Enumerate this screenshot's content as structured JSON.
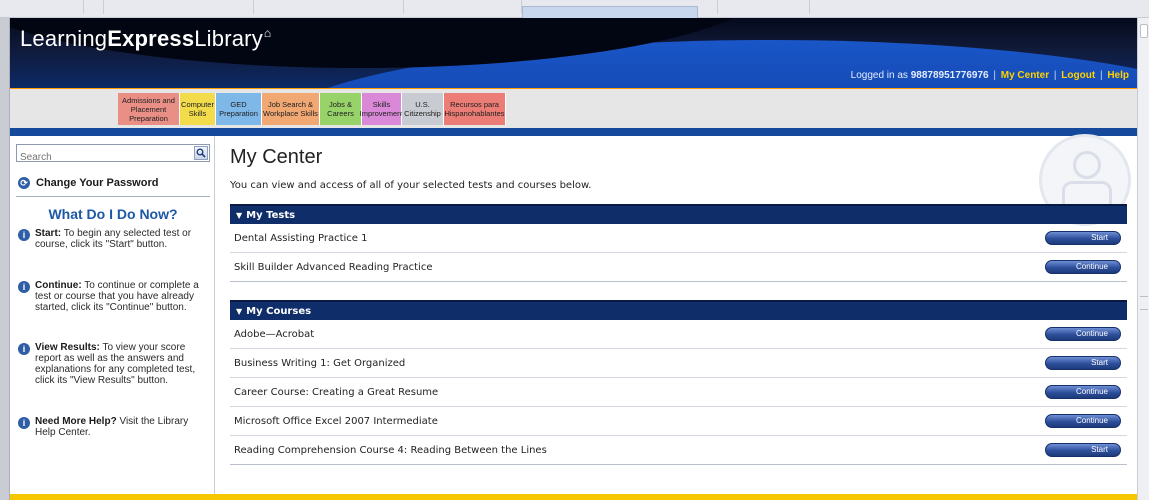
{
  "header": {
    "logo": {
      "part1": "Learning",
      "part2": "Express",
      "part3": "Library",
      "mark": "⌂"
    },
    "login": {
      "prefix": "Logged in as",
      "account": "98878951776976",
      "my_center": "My Center",
      "logout": "Logout",
      "help": "Help"
    }
  },
  "categories": [
    {
      "label": "Admissions and Placement Preparation",
      "color": "#e98f86"
    },
    {
      "label": "Computer Skills",
      "color": "#f3dc4c"
    },
    {
      "label": "GED Preparation",
      "color": "#7db8e9"
    },
    {
      "label": "Job Search & Workplace Skills",
      "color": "#f1a873"
    },
    {
      "label": "Jobs & Careers",
      "color": "#98d36a"
    },
    {
      "label": "Skills Improvement",
      "color": "#d989d7"
    },
    {
      "label": "U.S. Citizenship",
      "color": "#c8cbd1"
    },
    {
      "label": "Recursos para Hispanohablantes",
      "color": "#ec7d76"
    }
  ],
  "sidebar": {
    "search_placeholder": "Search",
    "change_password": "Change Your Password",
    "help_title": "What Do I Do Now?",
    "items": [
      {
        "title": "Start:",
        "text": "To begin any selected test or course, click its \"Start\" button."
      },
      {
        "title": "Continue:",
        "text": "To continue or complete a test or course that you have already started, click its \"Continue\" button."
      },
      {
        "title": "View Results:",
        "text": "To view your score report as well as the answers and explanations for any completed test, click its \"View Results\" button."
      },
      {
        "title": "Need More Help?",
        "text": "Visit the Library Help Center."
      }
    ]
  },
  "main": {
    "title": "My Center",
    "intro": "You can view and access of all of your selected tests and courses below.",
    "tests": {
      "heading": "My Tests",
      "rows": [
        {
          "name": "Dental Assisting Practice 1",
          "action": "Start"
        },
        {
          "name": "Skill Builder Advanced Reading Practice",
          "action": "Continue"
        }
      ]
    },
    "courses": {
      "heading": "My Courses",
      "rows": [
        {
          "name": "Adobe—Acrobat",
          "action": "Continue"
        },
        {
          "name": "Business Writing 1: Get Organized",
          "action": "Start"
        },
        {
          "name": "Career Course: Creating a Great Resume",
          "action": "Continue"
        },
        {
          "name": "Microsoft Office Excel 2007 Intermediate",
          "action": "Continue"
        },
        {
          "name": "Reading Comprehension Course 4: Reading Between the Lines",
          "action": "Start"
        }
      ]
    }
  },
  "colors": {
    "header_dark": "#050a1c",
    "header_blue": "#1a56c8",
    "nav_rule": "#14499c",
    "panel_head": "#0f2d68",
    "link_gold": "#ffd200",
    "footer": "#f6c700"
  }
}
